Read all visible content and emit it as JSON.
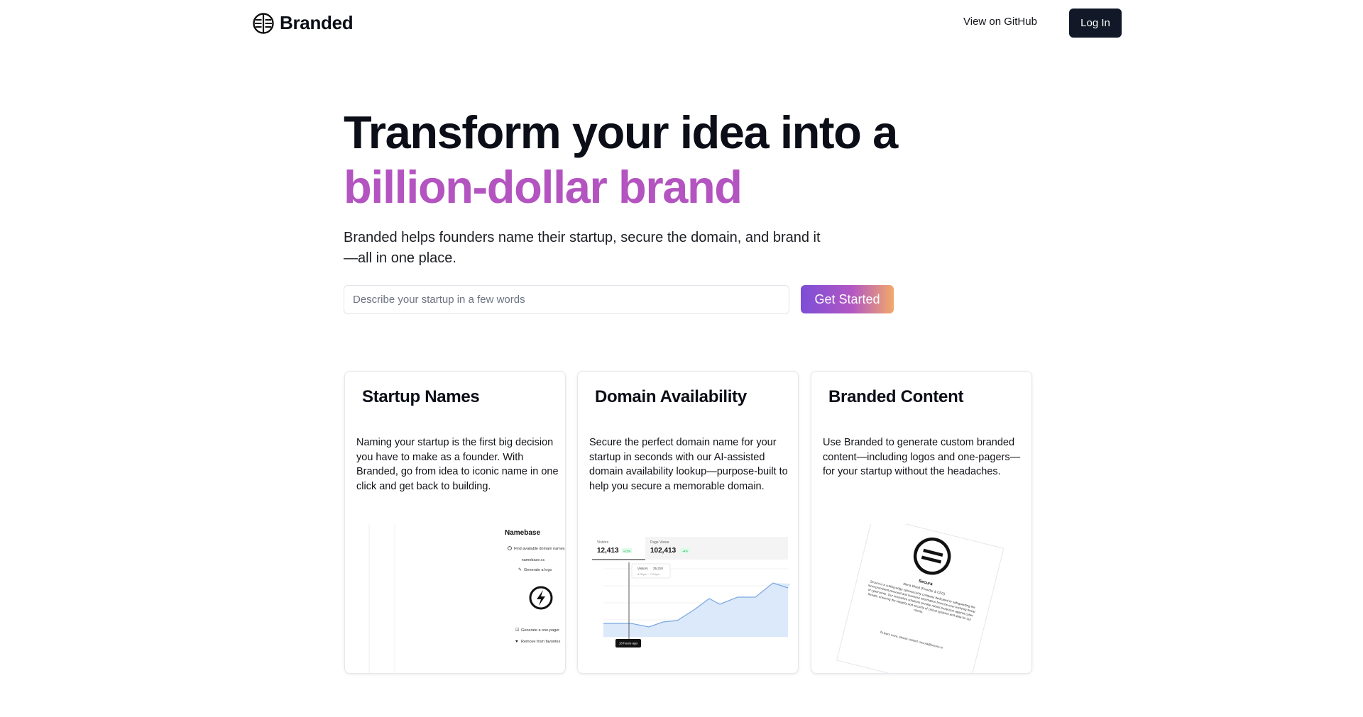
{
  "header": {
    "brand_name": "Branded",
    "github_link": "View on GitHub",
    "login_button": "Log In"
  },
  "hero": {
    "title_line1": "Transform your idea into a",
    "title_line2": "billion-dollar brand",
    "subtitle": "Branded helps founders name their startup, secure the domain, and brand it—all in one place.",
    "input_placeholder": "Describe your startup in a few words",
    "cta_button": "Get Started"
  },
  "colors": {
    "accent": "#b354c0",
    "dark": "#111827",
    "gradient_start": "#7c4ed6",
    "gradient_end": "#f2a96a"
  },
  "cards": [
    {
      "title": "Startup Names",
      "body": "Naming your startup is the first big decision you have to make as a founder. With Branded, go from idea to iconic name in one click and get back to building.",
      "illustration": {
        "panel_title": "Namebase",
        "menu": [
          "Find available domain names",
          "namebase.cc",
          "Generate a logo"
        ],
        "actions": [
          "Generate a one-pager",
          "Remove from favorites"
        ],
        "logo_icon": "lightning-bolt-icon"
      }
    },
    {
      "title": "Domain Availability",
      "body": "Secure the perfect domain name for your startup in seconds with our AI-assisted domain availability lookup—purpose-built to help you secure a memorable domain.",
      "illustration": {
        "tabs": [
          {
            "label": "Visitors",
            "value": "12,413",
            "badge": "+12%"
          },
          {
            "label": "Page Views",
            "value": "102,413",
            "badge": "+4%"
          }
        ],
        "tooltip_label": "Visitors",
        "tooltip_value": "25,310",
        "tooltip_time": "8:00pm – 7:00pm",
        "marker_label": "18 hours ago"
      }
    },
    {
      "title": "Branded Content",
      "body": "Use Branded to generate custom branded content—including logos and one-pagers—for your startup without the headaches.",
      "illustration": {
        "doc_title": "Secura",
        "doc_author": "Alena Wood (Founder & CEO)",
        "doc_text": "Secura is a cutting-edge cybersecurity company dedicated to safeguarding the most prominent personal and business information from the ever-evolving threat of cybercrime. Our innovative solutions provide robust protection against cyber threats, ensuring the integrity and security of critical systems and data for our clients.",
        "doc_footer": "To learn more, please contact: secura@secure.io",
        "logo_icon": "secura-logo-icon"
      }
    }
  ]
}
